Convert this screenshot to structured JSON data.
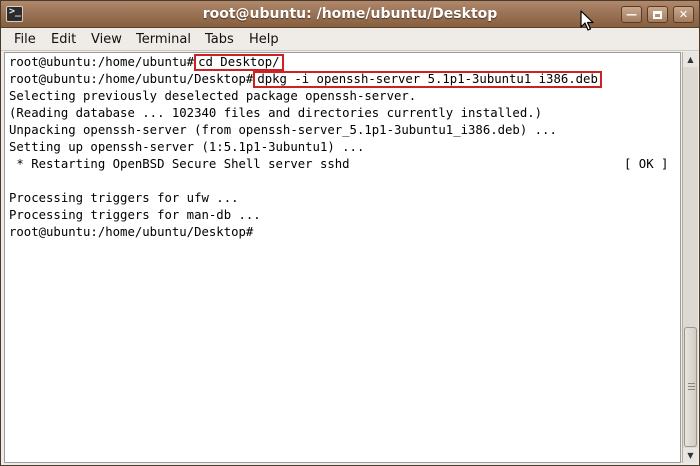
{
  "window": {
    "title": "root@ubuntu: /home/ubuntu/Desktop"
  },
  "menu": {
    "file": "File",
    "edit": "Edit",
    "view": "View",
    "terminal": "Terminal",
    "tabs": "Tabs",
    "help": "Help"
  },
  "terminal": {
    "lines": {
      "l1_prompt": "root@ubuntu:/home/ubuntu#",
      "l1_cmd": "cd Desktop/",
      "l2_prompt": "root@ubuntu:/home/ubuntu/Desktop#",
      "l2_cmd": "dpkg -i openssh-server 5.1p1-3ubuntu1 i386.deb",
      "l3": "Selecting previously deselected package openssh-server.",
      "l4": "(Reading database ... 102340 files and directories currently installed.)",
      "l5": "Unpacking openssh-server (from openssh-server_5.1p1-3ubuntu1_i386.deb) ...",
      "l6": "Setting up openssh-server (1:5.1p1-3ubuntu1) ...",
      "l7": " * Restarting OpenBSD Secure Shell server sshd",
      "l7_status": "[ OK ]",
      "l9": "Processing triggers for ufw ...",
      "l10": "Processing triggers for man-db ...",
      "l11_prompt": "root@ubuntu:/home/ubuntu/Desktop#"
    }
  },
  "icons": {
    "window_icon": "terminal-icon",
    "minimize": "minimize-icon",
    "maximize": "maximize-icon",
    "close": "close-icon",
    "cursor": "mouse-pointer-icon"
  },
  "colors": {
    "titlebar": "#9b7356",
    "highlight_box": "#cc2222",
    "terminal_bg": "#ffffff",
    "terminal_fg": "#000000"
  }
}
